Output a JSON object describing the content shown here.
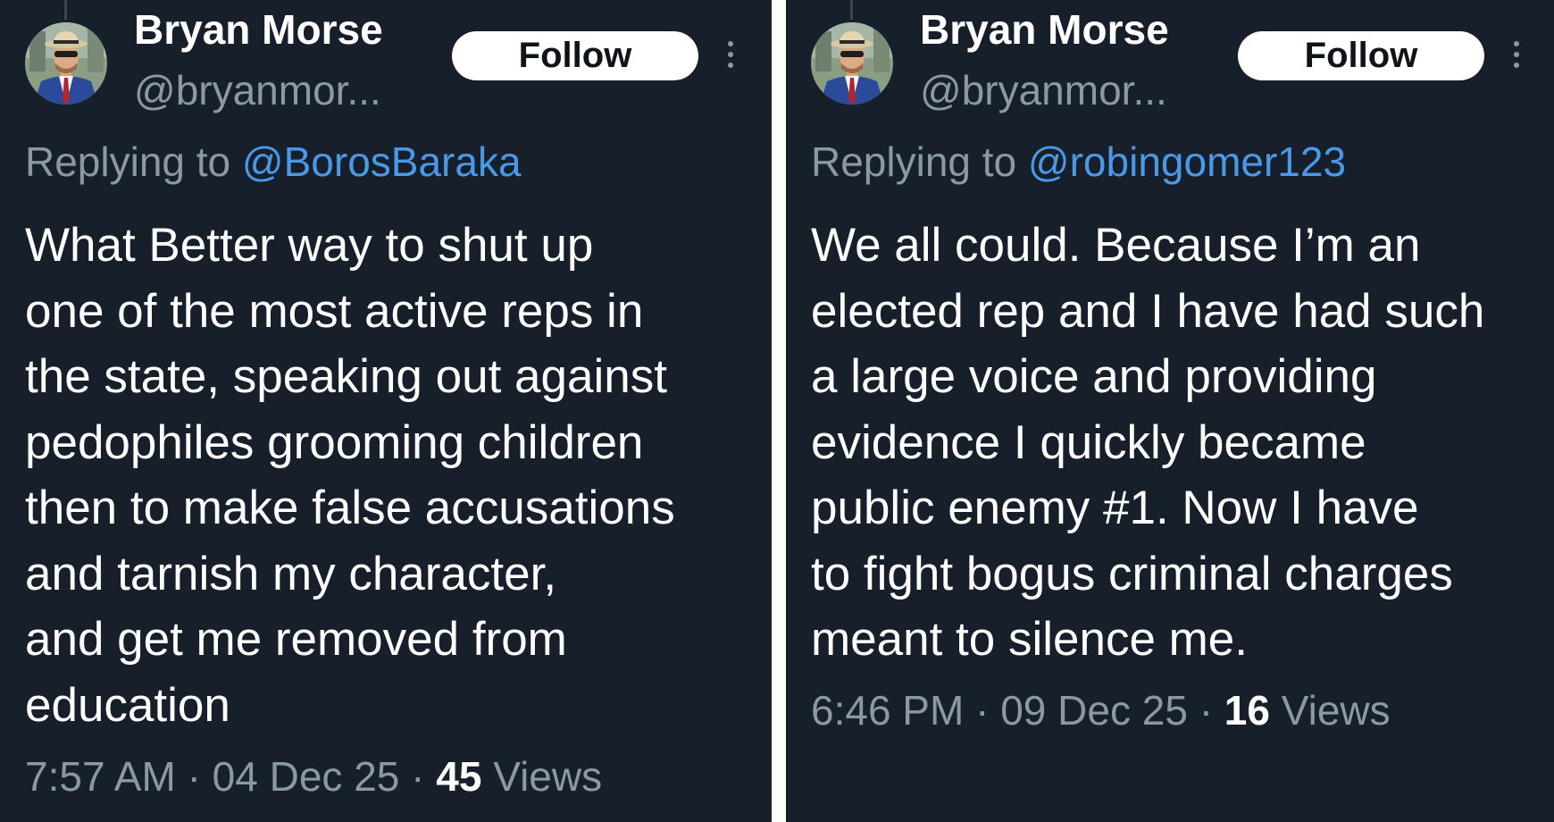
{
  "tweets": [
    {
      "author": {
        "display_name": "Bryan Morse",
        "handle": "@bryanmor..."
      },
      "follow_label": "Follow",
      "more_icon": "more-vertical-icon",
      "replying_prefix": "Replying to",
      "replying_to": "@BorosBaraka",
      "text_lines": [
        "What Better way to shut up",
        "one of the most active reps in",
        "the state, speaking out against",
        "pedophiles grooming children",
        "then to make false accusations",
        "and tarnish my character,",
        "and get me removed from",
        "education"
      ],
      "time": "7:57 AM",
      "date": "04 Dec 25",
      "separator": "·",
      "views_count": "45",
      "views_label": "Views"
    },
    {
      "author": {
        "display_name": "Bryan Morse",
        "handle": "@bryanmor..."
      },
      "follow_label": "Follow",
      "more_icon": "more-vertical-icon",
      "replying_prefix": "Replying to",
      "replying_to": "@robingomer123",
      "text_lines": [
        "We all could. Because I’m an",
        "elected rep and I have had such",
        "a large voice and providing",
        "evidence I quickly became",
        "public enemy #1. Now I have",
        "to fight bogus criminal charges",
        "meant to silence me."
      ],
      "time": "6:46 PM",
      "date": "09 Dec 25",
      "separator": "·",
      "views_count": "16",
      "views_label": "Views"
    }
  ],
  "colors": {
    "background": "#17202a",
    "divider": "#ffffff",
    "text_primary": "#ffffff",
    "text_secondary": "#8b98a5",
    "link": "#4a99e9",
    "button_bg": "#ffffff",
    "button_text": "#0f1419"
  }
}
